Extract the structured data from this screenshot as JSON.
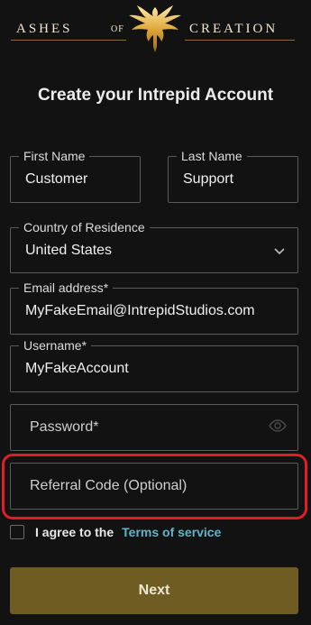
{
  "brand": {
    "left_text": "ASHES",
    "of_text": "OF",
    "right_text": "CREATION"
  },
  "title": "Create your Intrepid Account",
  "form": {
    "first_name": {
      "label": "First Name",
      "value": "Customer"
    },
    "last_name": {
      "label": "Last Name",
      "value": "Support"
    },
    "country": {
      "label": "Country of Residence",
      "value": "United States"
    },
    "email": {
      "label": "Email address*",
      "value": "MyFakeEmail@IntrepidStudios.com"
    },
    "username": {
      "label": "Username*",
      "value": "MyFakeAccount"
    },
    "password": {
      "placeholder": "Password*"
    },
    "referral": {
      "placeholder": "Referral Code (Optional)"
    }
  },
  "agree": {
    "text": "I agree to the",
    "link": "Terms of service",
    "checked": false
  },
  "next_label": "Next",
  "colors": {
    "background": "#121212",
    "accent_gold": "#6f5c23",
    "link_teal": "#5fb6c8",
    "highlight_red": "#e01e27"
  },
  "icons": {
    "logo": "phoenix-logo-icon",
    "dropdown": "chevron-down-icon",
    "password_visibility": "eye-icon"
  }
}
